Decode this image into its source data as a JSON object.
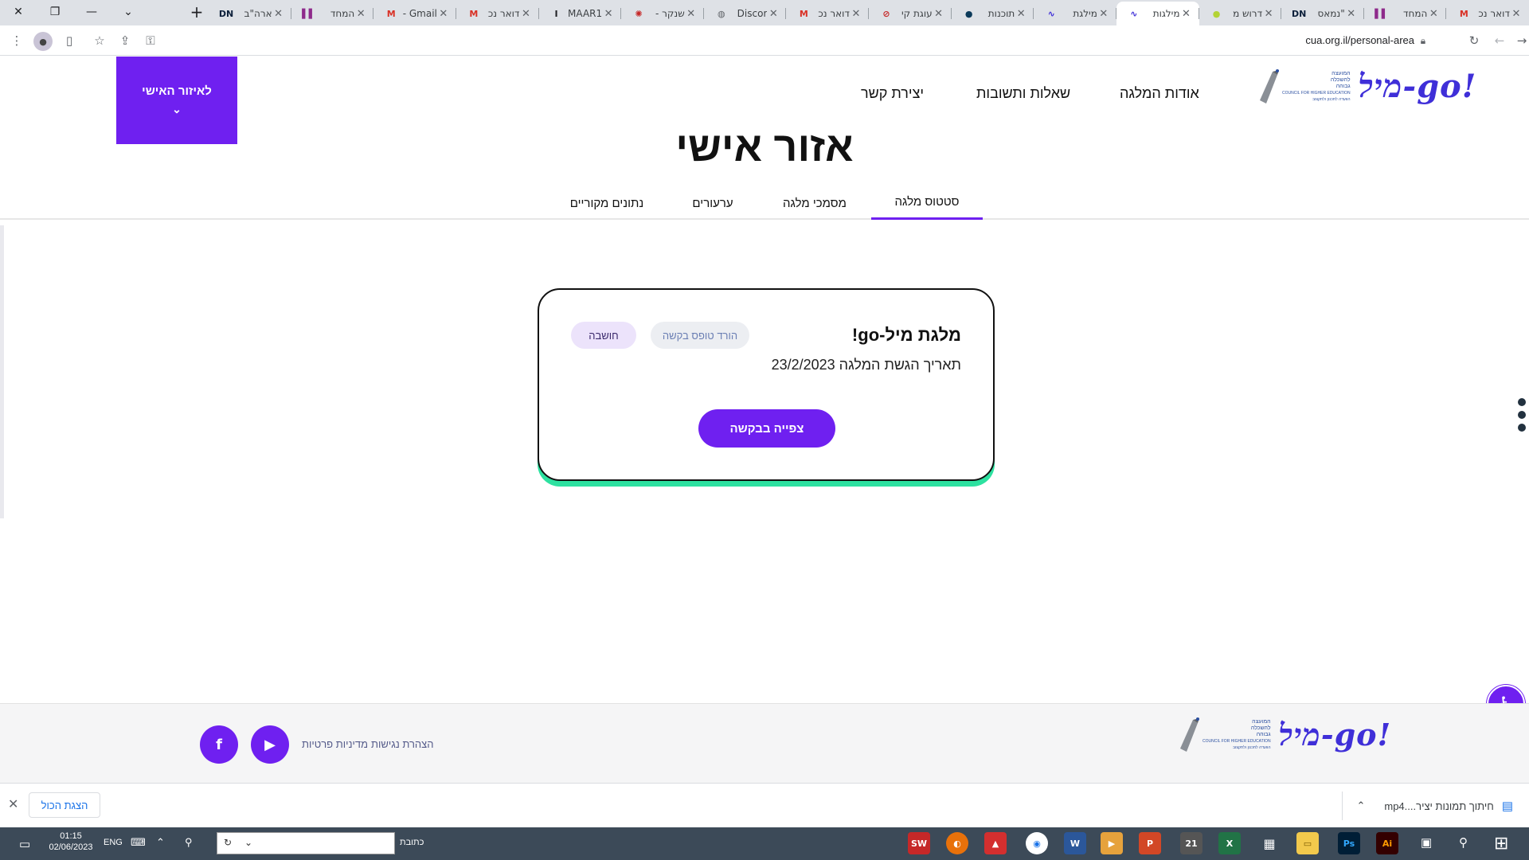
{
  "browser": {
    "tabs": [
      {
        "title": "דואר נכ",
        "icon": "gmail-icon",
        "icon_glyph": "M",
        "icon_color": "#d93025"
      },
      {
        "title": "המחד",
        "icon": "bars-icon",
        "icon_glyph": "▌▌",
        "icon_color": "#8e2a8b"
      },
      {
        "title": "\"נמאס",
        "icon": "dn-icon",
        "icon_glyph": "DN",
        "icon_color": "#0b1f3a"
      },
      {
        "title": "דרוש מ",
        "icon": "green-circle-icon",
        "icon_glyph": "●",
        "icon_color": "#b3d335"
      },
      {
        "title": "מילגות",
        "icon": "milgo-icon",
        "icon_glyph": "∿",
        "icon_color": "#3f2fd8",
        "active": true
      },
      {
        "title": "מילגת",
        "icon": "milgo-icon",
        "icon_glyph": "∿",
        "icon_color": "#3f2fd8"
      },
      {
        "title": "תוכנות",
        "icon": "dark-circle-icon",
        "icon_glyph": "●",
        "icon_color": "#0b3a5a"
      },
      {
        "title": "עוגת קי",
        "icon": "red-swirl-icon",
        "icon_glyph": "⊘",
        "icon_color": "#c62828"
      },
      {
        "title": "דואר נכ",
        "icon": "gmail-icon",
        "icon_glyph": "M",
        "icon_color": "#d93025"
      },
      {
        "title": "Discor",
        "icon": "globe-icon",
        "icon_glyph": "◍",
        "icon_color": "#5f6368"
      },
      {
        "title": "שנקר -",
        "icon": "dotted-icon",
        "icon_glyph": "✺",
        "icon_color": "#c62828"
      },
      {
        "title": "MAAR1",
        "icon": "i-icon",
        "icon_glyph": "I",
        "icon_color": "#202124"
      },
      {
        "title": "דואר נכ",
        "icon": "gmail-icon",
        "icon_glyph": "M",
        "icon_color": "#d93025"
      },
      {
        "title": "Gmail -",
        "icon": "gmail-icon",
        "icon_glyph": "M",
        "icon_color": "#d93025"
      },
      {
        "title": "המחד",
        "icon": "bars-icon",
        "icon_glyph": "▌▌",
        "icon_color": "#8e2a8b"
      },
      {
        "title": "ארה\"ב",
        "icon": "dn-icon",
        "icon_glyph": "DN",
        "icon_color": "#0b1f3a"
      }
    ],
    "url": "cua.org.il/personal-area"
  },
  "site": {
    "logo_text": "מיל-go!",
    "che_text_lines": [
      "המועצה",
      "להשכלה",
      "גבוהה",
      "COUNCIL FOR HIGHER EDUCATION",
      "הוועדה לתכנון ולתקצוב"
    ],
    "nav": {
      "about": "אודות המלגה",
      "faq": "שאלות ותשובות",
      "contact": "יצירת קשר"
    },
    "personal_area_button": "לאיזור האישי",
    "page_title": "אזור אישי",
    "subtabs": [
      {
        "label": "סטטוס מלגה",
        "active": true
      },
      {
        "label": "מסמכי מלגה"
      },
      {
        "label": "ערעורים"
      },
      {
        "label": "נתונים מקוריים"
      }
    ]
  },
  "card": {
    "title": "מלגת מיל-go!",
    "date_label": "תאריך הגשת המלגה",
    "date_value": "23/2/2023",
    "download_label": "הורד טופס בקשה",
    "status_label": "חושבה",
    "view_button": "צפייה בבקשה"
  },
  "footer": {
    "accessibility_statement": "הצהרת נגישות",
    "privacy_policy": "מדיניות פרטיות"
  },
  "downloads": {
    "file_name": "חיתוך תמונות יציר....mp4",
    "show_all": "הצגת הכול"
  },
  "taskbar": {
    "time": "01:15",
    "date": "02/06/2023",
    "lang": "ENG",
    "address_label": "כתובת"
  },
  "colors": {
    "brand_purple": "#6f20f0",
    "card_accent_green": "#2de1a0",
    "logo_blue": "#3f2fd8"
  }
}
